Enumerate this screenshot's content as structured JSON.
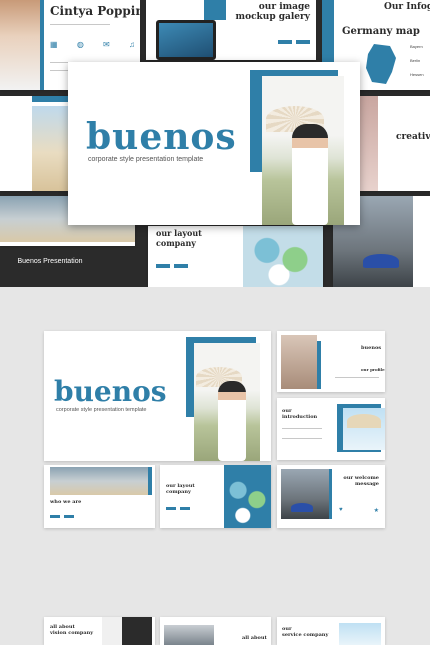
{
  "hero": {
    "title": "buenos",
    "subtitle": "corporate style presentation template"
  },
  "top_slides": {
    "cintya": "Cintya Poppins",
    "image_mockup": "our image\nmockup galery",
    "germany": "Germany map",
    "infograph": "Our Infograph",
    "creative": "creative p",
    "layout": "our layout\ncompany",
    "badge": "Buenos Presentation",
    "map_cities": [
      "Bayern",
      "Berlin",
      "Hessen"
    ]
  },
  "grid": {
    "buenos_small": "buenos",
    "our_profile": "our profile",
    "introduction": "our\nintroduction",
    "who_we_are": "who we are",
    "layout_company": "our layout\ncompany",
    "welcome": "our welcome\nmessage",
    "vision": "all about\nvision company",
    "all_about": "all about",
    "service": "our\nservice company"
  },
  "colors": {
    "accent": "#2f7fa8",
    "dark": "#2b2b2b"
  }
}
